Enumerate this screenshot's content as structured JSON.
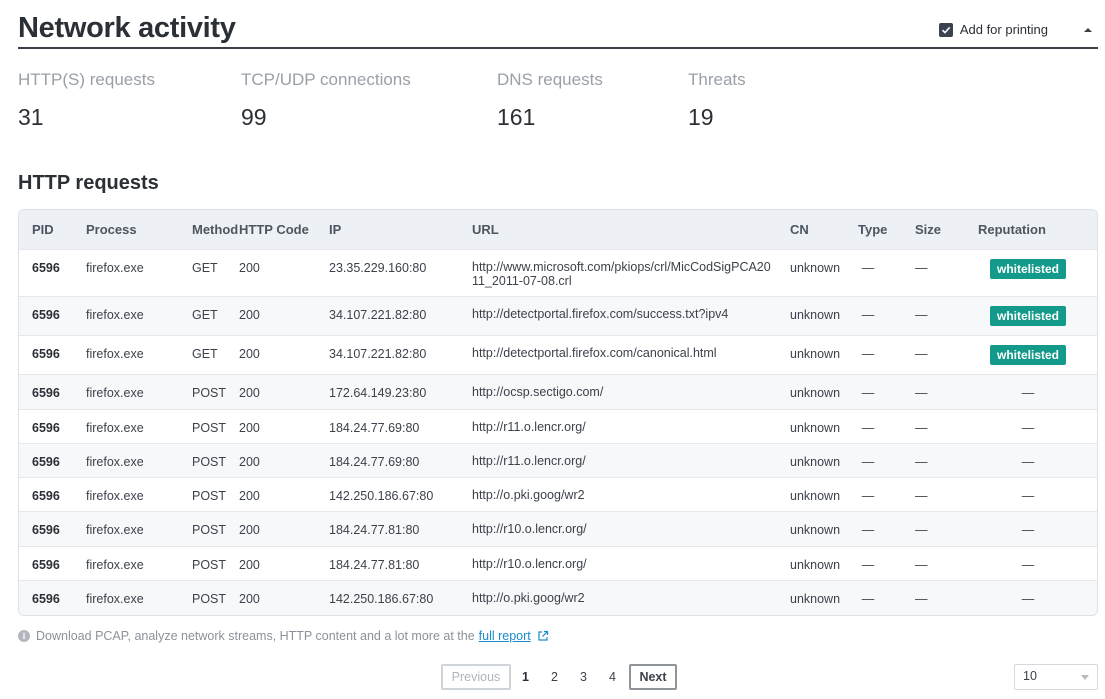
{
  "header": {
    "title": "Network activity",
    "print_label": "Add for printing",
    "print_checked": true
  },
  "stats": [
    {
      "label": "HTTP(S) requests",
      "value": "31"
    },
    {
      "label": "TCP/UDP connections",
      "value": "99"
    },
    {
      "label": "DNS requests",
      "value": "161"
    },
    {
      "label": "Threats",
      "value": "19"
    }
  ],
  "section_title": "HTTP requests",
  "table": {
    "columns": [
      "PID",
      "Process",
      "Method",
      "HTTP Code",
      "IP",
      "URL",
      "CN",
      "Type",
      "Size",
      "Reputation"
    ],
    "rows": [
      {
        "pid": "6596",
        "process": "firefox.exe",
        "method": "GET",
        "code": "200",
        "ip": "23.35.229.160:80",
        "url": "http://www.microsoft.com/pkiops/crl/MicCodSigPCA2011_2011-07-08.crl",
        "cn": "unknown",
        "type": "—",
        "size": "—",
        "reputation": "whitelisted"
      },
      {
        "pid": "6596",
        "process": "firefox.exe",
        "method": "GET",
        "code": "200",
        "ip": "34.107.221.82:80",
        "url": "http://detectportal.firefox.com/success.txt?ipv4",
        "cn": "unknown",
        "type": "—",
        "size": "—",
        "reputation": "whitelisted"
      },
      {
        "pid": "6596",
        "process": "firefox.exe",
        "method": "GET",
        "code": "200",
        "ip": "34.107.221.82:80",
        "url": "http://detectportal.firefox.com/canonical.html",
        "cn": "unknown",
        "type": "—",
        "size": "—",
        "reputation": "whitelisted"
      },
      {
        "pid": "6596",
        "process": "firefox.exe",
        "method": "POST",
        "code": "200",
        "ip": "172.64.149.23:80",
        "url": "http://ocsp.sectigo.com/",
        "cn": "unknown",
        "type": "—",
        "size": "—",
        "reputation": "—"
      },
      {
        "pid": "6596",
        "process": "firefox.exe",
        "method": "POST",
        "code": "200",
        "ip": "184.24.77.69:80",
        "url": "http://r11.o.lencr.org/",
        "cn": "unknown",
        "type": "—",
        "size": "—",
        "reputation": "—"
      },
      {
        "pid": "6596",
        "process": "firefox.exe",
        "method": "POST",
        "code": "200",
        "ip": "184.24.77.69:80",
        "url": "http://r11.o.lencr.org/",
        "cn": "unknown",
        "type": "—",
        "size": "—",
        "reputation": "—"
      },
      {
        "pid": "6596",
        "process": "firefox.exe",
        "method": "POST",
        "code": "200",
        "ip": "142.250.186.67:80",
        "url": "http://o.pki.goog/wr2",
        "cn": "unknown",
        "type": "—",
        "size": "—",
        "reputation": "—"
      },
      {
        "pid": "6596",
        "process": "firefox.exe",
        "method": "POST",
        "code": "200",
        "ip": "184.24.77.81:80",
        "url": "http://r10.o.lencr.org/",
        "cn": "unknown",
        "type": "—",
        "size": "—",
        "reputation": "—"
      },
      {
        "pid": "6596",
        "process": "firefox.exe",
        "method": "POST",
        "code": "200",
        "ip": "184.24.77.81:80",
        "url": "http://r10.o.lencr.org/",
        "cn": "unknown",
        "type": "—",
        "size": "—",
        "reputation": "—"
      },
      {
        "pid": "6596",
        "process": "firefox.exe",
        "method": "POST",
        "code": "200",
        "ip": "142.250.186.67:80",
        "url": "http://o.pki.goog/wr2",
        "cn": "unknown",
        "type": "—",
        "size": "—",
        "reputation": "—"
      }
    ]
  },
  "footer": {
    "note": "Download PCAP, analyze network streams, HTTP content and a lot more at the",
    "link": "full report"
  },
  "pagination": {
    "previous": "Previous",
    "pages": [
      "1",
      "2",
      "3",
      "4"
    ],
    "current": "1",
    "next": "Next",
    "page_size": "10"
  },
  "colors": {
    "badge": "#149a8b",
    "link": "#1a8bc9"
  }
}
